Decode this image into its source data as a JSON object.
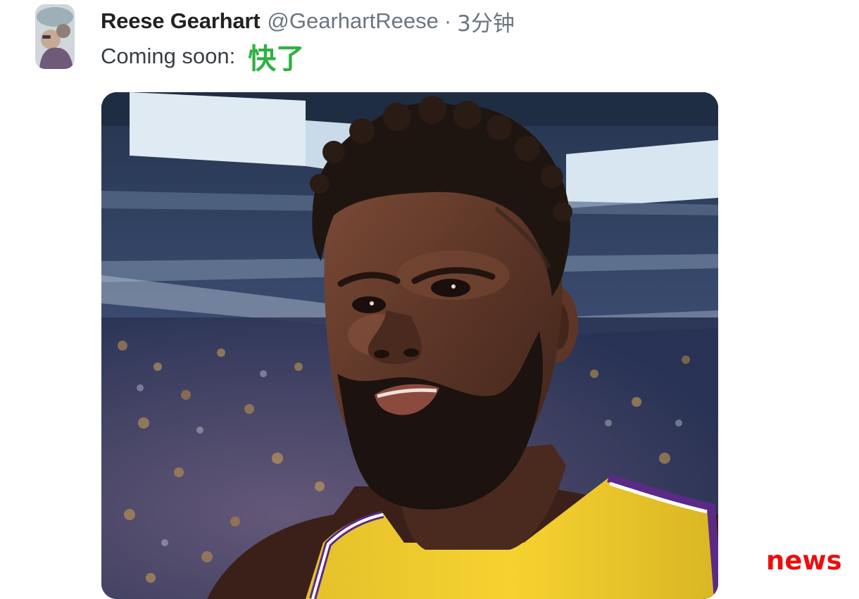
{
  "tweet": {
    "author_name": "Reese Gearhart",
    "author_handle": "@GearhartReese",
    "separator": "·",
    "timestamp": "3分钟",
    "text_plain": "Coming soon:",
    "text_emphasis": "快了"
  },
  "colors": {
    "emphasis_text": "#2fb142",
    "watermark": "#ee0d0d",
    "jersey_gold": "#f6d230",
    "jersey_trim": "#5b2a86"
  },
  "watermark": "news"
}
